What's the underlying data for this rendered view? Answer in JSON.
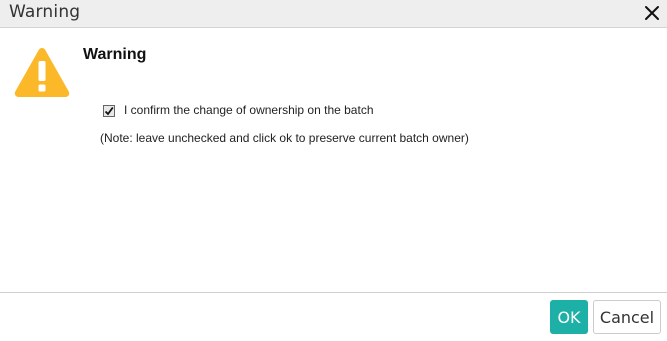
{
  "dialog": {
    "title": "Warning",
    "heading": "Warning",
    "checkbox": {
      "label": "I confirm the change of ownership on the batch",
      "checked": true
    },
    "note": "(Note: leave unchecked and click ok to preserve current batch owner)",
    "buttons": {
      "ok_label": "OK",
      "cancel_label": "Cancel"
    },
    "icons": {
      "close": "close-icon",
      "warning": "warning-triangle-icon",
      "check": "check-icon"
    },
    "colors": {
      "warning": "#fbb829",
      "ok_button": "#1db0a6",
      "titlebar": "#eeeeee"
    }
  }
}
